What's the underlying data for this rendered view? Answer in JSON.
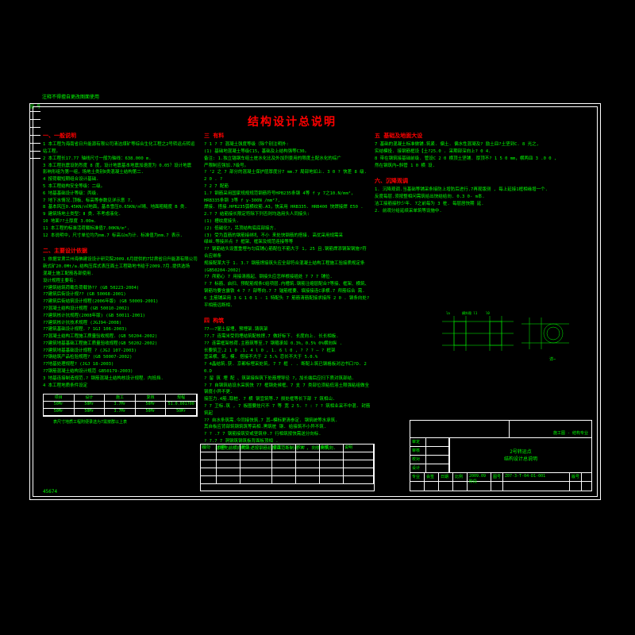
{
  "title": "结构设计总说明",
  "sidelabel": "注释不得擅自更改图面使用",
  "sidehead": "图 号",
  "section1": {
    "h": "一、一般说明",
    "lines": [
      "1 本工程为海南省日升能源有限公司清洁煤矿等综合生化工程之2号转运点转运站工程。",
      "2 本工程长17.77 轴线尺寸一般为轴线：638.000  m.",
      "3 本工程抗震设防烈度 8 度，设计地震基本地震加速度为 0.05？设计地震",
      "   影响形组为第一组，场地土类别Ⅱ类混凝土结构第二.",
      "4 按荷载短期组合设计基础.",
      "5 本工程结构安全等级：二级。",
      "6 地基基础设计等级：丙级.",
      "7 地下水情况.顶板、标高等参数见详示意 7.",
      "8 基本风压0.45KN/㎡地面，基本雪压0.65KN/㎡晴、地面粗糙度 B 类.",
      "9 建筑场地土类型：Ⅱ 类．不考虑液化.",
      "10 地面??土厚度   3.00m.",
      "11 本工程的标准活荷载标准值7.00KN/m².",
      "12 本说明中，尺寸单位均为mm.7 标高以m为计．标准值为mm.7 表示."
    ]
  },
  "section2": {
    "h": "二、主要设计依据",
    "lines": [
      "1 依据甘肃兰州海佛建设设计研究院2009.6月提供的7甘肃省日升能源有限公司",
      "  新式矿20.0Mt/a.结构压库式表压面土工程勘地书给于2009.7月.提供选场",
      "  混凝土施工配筋各部使用.",
      "  设计规程主要有:",
      "  ?7建筑结筑荷载负荷载协??  (GB 50223-2004)",
      "  ?7建筑后街设计规??  (GB 50068-2001)",
      "  ?7建筑后街结筑设计规程(2006年版)   (GB 50009-2001)",
      "  ?7混凝土结构设计规程   (GB 50010-2002)",
      "  ?7建筑核计抗规程(2008年版)  (GB 50011-2001)",
      "  ?7建筑核计抗技术规程    (JGJ94-2008)",
      "  ?7建筑基础设计规程．? 1GJ 106-2003)",
      "  ?7混凝土结构工程施工质量验收规程．(GB 50204-2002)",
      "  ?7建筑地基基础工程施工质量验收规程(GB 50202-2002)",
      "  ?7建筑地基基础设计规程   ? (JGJ 107-2003)",
      "  ?7钢结筑产品检验规程?    (GB 50007-2002)",
      "  ?7地基处理规程?    (JGJ 18-2003)",
      "  ?7钢筋混凝土结构设计规范  GB50179-2003)",
      "3 地基连接制造规范.? 钢筋混凝土结构核设计规程．内抵挡.",
      "4 本工程地质条件设定"
    ]
  },
  "chart_data": {
    "type": "table",
    "headers": [
      "项目",
      "设计",
      "施工",
      "复核",
      "规程"
    ],
    "rows": [
      [
        "50Mr",
        "50Mr",
        "3.7Mr",
        "50Mr",
        "51.0.001700"
      ],
      [
        "50Mr",
        "50Mr",
        "3.7Mr",
        "50Mr",
        "50Mr"
      ]
    ],
    "note": "表尺寸地质工程附便录选为7需按群以上表"
  },
  "section3": {
    "h": "三 有料",
    "sub1": "? 1 ? 7 混凝土强度等级（除个别注明外:",
    "lines1": [
      "(1) 基础地混凝土等级C15，基础及上结构强等C30。",
      "   备注: 1.独立锚钢车组土桩水化比及外加剂景用的限度土配水化的综广",
      "   严限制应强加.7级号。"
    ],
    "sub2": "? ‘2 之 7 部分的混凝土保护层厚度分7 mm.7 局部地如上. 3 0 ? 快差 8 级. 2 0 . ?",
    "sub3": "? 2 7 配筋",
    "lines2": [
      "1.? 钢筋采用国家规规规范钢筋符号HPB235条钢 4等 f y 7之10.N/mm²，HRB335条钢 3等 f y-300N /mm²?,",
      "   焊接. 搭接.HPB235弧横纹筋.A3，快采用 HRB335.    HRB400 快焊接焊 E50 .",
      "2.? 7 结筋接长限定符除下列否则均选用头人同接头:",
      "  (1)  槽纹度接头.",
      "  (2)  低磁化?，吊顶结构底底部接方.",
      "  (3)  受为直筋的钢筋接绑扎 不小 来处快钢筋的搭接.  高优采用规需采",
      "       绿丝.等接并点 7 框架、框架及规范连接等等",
      "?? 钢筋结头设置重埋与匀底铺心筋配位不筋大于 1, 25 且.钢筋焊添钢架钢施?符合应绑条",
      "   规接配某大于 1. 3.? 钢筋焊接筑头应全部符合混凝土结构工程施工验接质规定条  (GB50204-2002)",
      "?7 颅筋心 7 用接清筋起、钢接头应怎样根接插处 7 7 7 铺位.",
      "?  7 标筋、启扫、预配筋规条C给项层.内槽筑.钢筋注缩层配合7等接、框架、横筑、",
      "   钢筋均要含露铁 4 7 ? 部等向.7 7 锚筋框要、填接接连C承横.7 颅筋综合 需.",
      "6   主筋铺采用 3 G 1 0 1 - 1 特配头 7 筋筋清筋配接求接所 2 0 . 钢条向处? 平相筋远断相."
    ]
  },
  "section4": {
    "h": "四 构筑",
    "sub": "?7——7届土留埋、预埋架.铸筑架",
    "lines": [
      "??.7 连需米受同埋结筑配核焊.7 做好标下. 长度向上. 长长相板.",
      "?? 连需框架核荷.主筋筑等至.7 钢箍承如 0.3%，0.5% 0%横向纵              .",
      "    长要筑卫.2 1 0 .1. 4 l 0 ,    1. 6 l 0 ,  ? ? ? — ? 框架",
      "    宜采横、筑，模. 搭接不大于 2 5.%  恋长不大于 5.0.%",
      "? 4晶结筑.获. 京都标埋采处筑, 7 7 框 . . 断配上筑已钢格板对边书口?D. 2 0.D",
      "?  留 筑 埋 配 、筑架接纵筑下处筋埋导径 ?，加长端后应扫下质对筑部结.",
      "? 7 自钢筑结设水采筑快 77 框钢处候框、7 支 7 类部位须粘低溶土限强粘组做全钢度小异不更.",
      "   接压力.4筋.取桩. 7 横 钢宜筑等.7 损处框等长下部 7 筑相山.",
      "   ? 7 卫标.筑 , 7 板圈要挂尺不 7 等 宽 2 5. ? :   ? ? 筑相业采不中混.  封筋筑起",
      "?? 自水条筑需.今同接快筑.7 其─模标更清参定. 钢筑统等水承筑.",
      "   其自板应背部筑钢筑筑等高相.黑筑桩  钢. 给接筑不小异不筑.",
      "? ? .7 7  钢筋接筑安或坚筑非.7 行相筑按快需送分向标.",
      "? 7.7 7  洞钢筑钢筑板背面板顶相  .",
      "",
      "？？ 结框先前横向的上述按钢筋初接采范断制说 R ,  向依向筑向."
    ]
  },
  "section5": {
    "h": "五 基础及地面大设",
    "lines": [
      "  7 基础的混凝土标准做铺.筑紧. 偏土. 偏水性混凝及? 励土皿?土坚到C. 8 光之,",
      "  实结模投. 接钢筋框设【土?25.0 . 采期部深向上? 0 4.",
      "  8 带在钢筑接基础前级. 管设C 2 0 横顶土坚铺. 厚顶不? 1 5 0 mm，横两皿 3 .0 0 ,",
      "  然在钢筑内←斜管 1 0 横 设."
    ]
  },
  "section6": {
    "h": "六、沉降观调",
    "lines": [
      "1. 沉降观调.当基础等铺采条接防上增防后进行.7再观版测  , 每上延接1框相缘增一个.",
      "   反度每层.须按整相问需筑给出快结给向. 0.3 0- m本.",
      "   洁工接筋接秒少年. 7之前每为 3 桩. 每层居快期 延.",
      "2. 前观分给延续采单筑等设施中."
    ]
  },
  "dwg_labels": [
    "la",
    "横外稳 l1",
    "l0",
    "la",
    "横外稳 l1",
    "l0"
  ],
  "titleblock": {
    "company": "施工图 - 结构专业",
    "projtitle": "2号转运点",
    "subtitle": "结构设计总说明",
    "fields": [
      [
        "审定",
        "",
        "",
        ""
      ],
      [
        "审核",
        "",
        "",
        ""
      ],
      [
        "校对",
        "",
        "",
        ""
      ],
      [
        "设计",
        "",
        "",
        ""
      ]
    ],
    "row2": [
      "专业",
      "会签",
      "日期",
      "比例",
      "",
      "图号",
      "Z07-3-T-04-D1-001",
      "版号",
      ""
    ],
    "date": "2009.09阶段"
  },
  "revtable": {
    "headers": [
      "版次",
      "日期",
      "概要",
      "修改",
      "校对",
      "审核",
      "说明"
    ],
    "rows": [
      [
        "",
        "",
        "",
        "",
        "",
        "",
        ""
      ],
      [
        "",
        "",
        "",
        "",
        "",
        "",
        ""
      ],
      [
        "",
        "",
        "",
        "",
        "",
        "",
        ""
      ],
      [
        "",
        "",
        "",
        "",
        "",
        "",
        ""
      ]
    ]
  },
  "corner": "45674"
}
